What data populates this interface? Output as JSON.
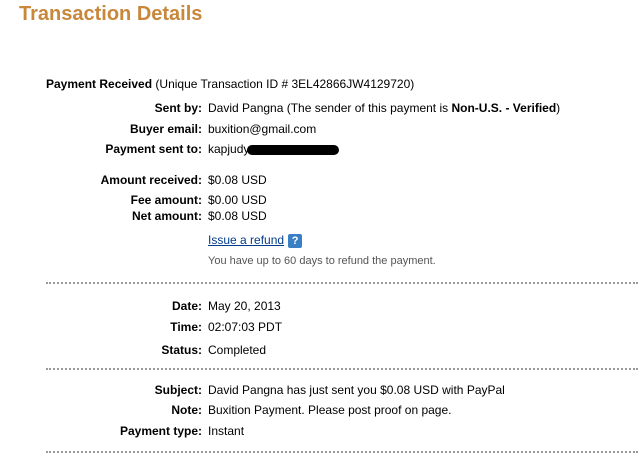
{
  "page": {
    "title": "Transaction Details"
  },
  "header": {
    "status_label": "Payment Received",
    "transaction_id_text": "(Unique Transaction ID # 3EL42866JW4129720)"
  },
  "sender": {
    "sent_by_label": "Sent by:",
    "sent_by_name": "David Pangna (The sender of this payment is",
    "sent_by_status": "Non-U.S. - Verified",
    "sent_by_close": ")",
    "buyer_email_label": "Buyer email:",
    "buyer_email_value": "buxition@gmail.com",
    "payment_sent_to_label": "Payment sent to:",
    "payment_sent_to_value": "kapjudy"
  },
  "amounts": {
    "amount_received_label": "Amount received:",
    "amount_received_value": "$0.08 USD",
    "fee_amount_label": "Fee amount:",
    "fee_amount_value": "$0.00 USD",
    "net_amount_label": "Net amount:",
    "net_amount_value": "$0.08 USD",
    "refund_link": "Issue a refund",
    "help_icon_glyph": "?",
    "refund_note": "You have up to 60 days to refund the payment."
  },
  "timing": {
    "date_label": "Date:",
    "date_value": "May 20, 2013",
    "time_label": "Time:",
    "time_value": "02:07:03 PDT",
    "status_label": "Status:",
    "status_value": "Completed"
  },
  "details": {
    "subject_label": "Subject:",
    "subject_value": "David Pangna has just sent you $0.08 USD with PayPal",
    "note_label": "Note:",
    "note_value": "Buxition Payment. Please post proof on page.",
    "payment_type_label": "Payment type:",
    "payment_type_value": "Instant"
  },
  "colors": {
    "title": "#c8873a",
    "link": "#003c8a",
    "help_icon": "#3a7fc4"
  }
}
